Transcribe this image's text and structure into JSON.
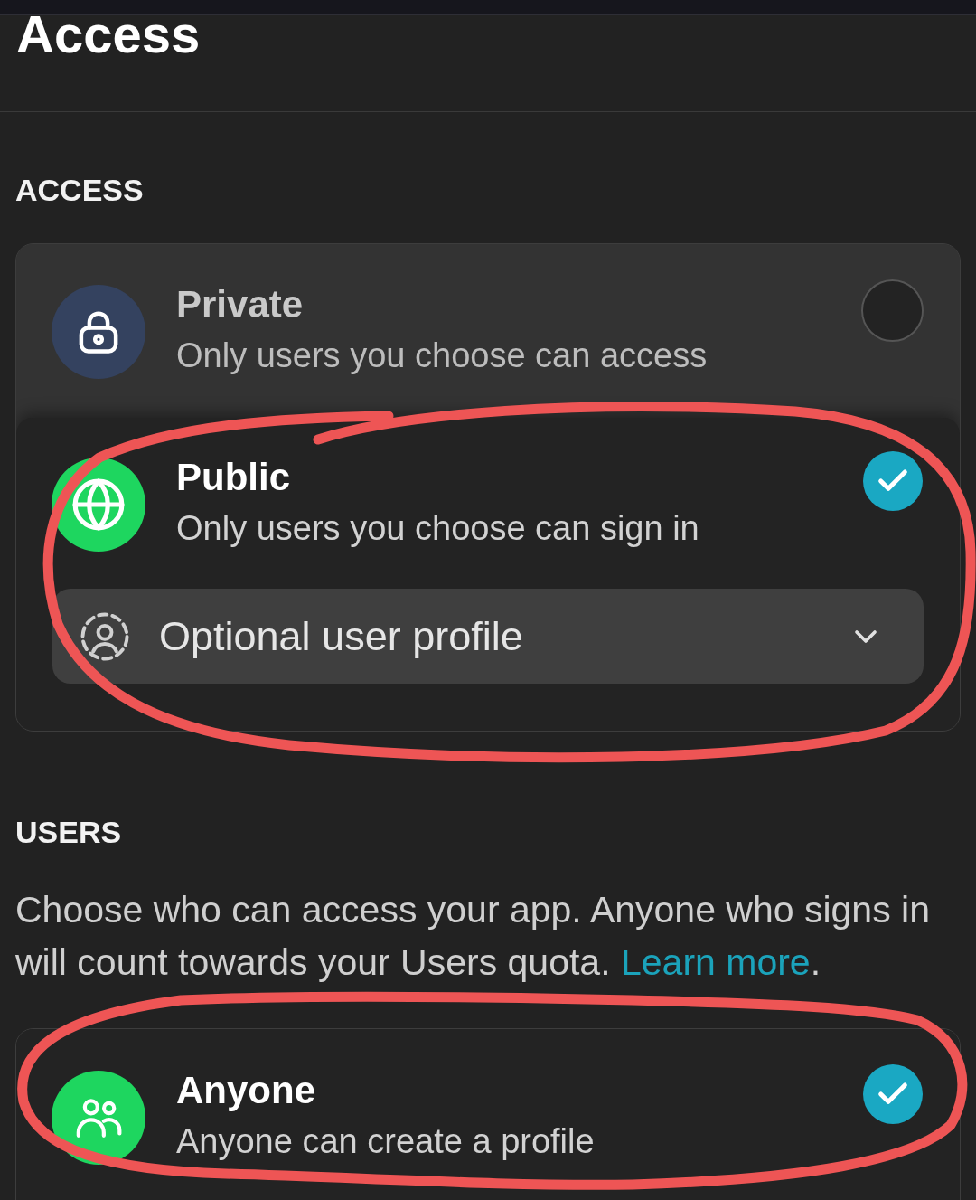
{
  "page": {
    "title": "Access"
  },
  "access": {
    "heading": "ACCESS",
    "options": [
      {
        "title": "Private",
        "description": "Only users you choose can access",
        "selected": false,
        "color": "#34425f"
      },
      {
        "title": "Public",
        "description": "Only users you choose can sign in",
        "selected": true,
        "color": "#1ed65f",
        "dropdown": {
          "value": "Optional user profile"
        }
      }
    ]
  },
  "users": {
    "heading": "USERS",
    "description": "Choose who can access your app. Anyone who signs in will count towards your Users quota.",
    "link": "Learn more",
    "after_link": ".",
    "options": [
      {
        "title": "Anyone",
        "description": "Anyone can create a profile",
        "selected": true,
        "color": "#1ed65f"
      }
    ]
  }
}
